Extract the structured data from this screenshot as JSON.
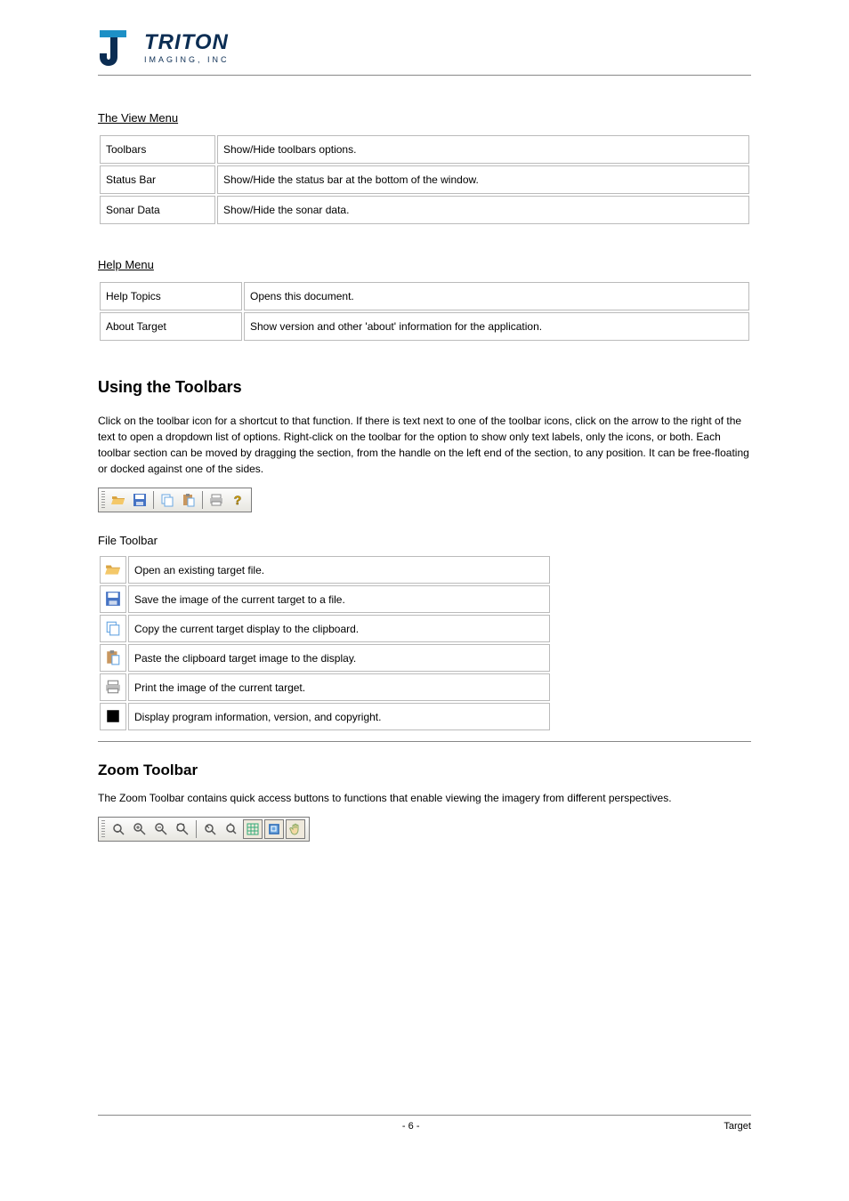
{
  "logo": {
    "company": "TRITON",
    "tagline": "IMAGING, INC"
  },
  "view_menu": {
    "heading": "The View Menu",
    "items": [
      {
        "name": "Toolbars",
        "desc": "Show/Hide toolbars options."
      },
      {
        "name": "Status Bar",
        "desc": "Show/Hide the status bar at the bottom of the window."
      },
      {
        "name": "Sonar Data",
        "desc": "Show/Hide the sonar data."
      }
    ]
  },
  "help_menu": {
    "heading": "Help Menu",
    "items": [
      {
        "name": "Help Topics",
        "desc": "Opens this document."
      },
      {
        "name": "About Target",
        "desc": "Show version and other 'about' information for the application."
      }
    ]
  },
  "toolbars_section": {
    "title": "Using the Toolbars",
    "intro": "Click on the toolbar icon for a shortcut to that function. If there is text next to one of the toolbar icons, click on the arrow to the right of the text to open a dropdown list of options. Right-click on the toolbar for the option to show only text labels, only the icons, or both. Each toolbar section can be moved by dragging the section, from the handle on the left end of the section, to any position. It can be free-floating or docked against one of the sides.",
    "file_toolbar": {
      "desc_title": "File Toolbar",
      "icons": [
        {
          "name": "open-icon",
          "desc": "Open an existing target file."
        },
        {
          "name": "save-icon",
          "desc": "Save the image of the current target to a file."
        },
        {
          "name": "copy-icon",
          "desc": "Copy the current target display to the clipboard."
        },
        {
          "name": "paste-icon",
          "desc": "Paste the clipboard target image to the display."
        },
        {
          "name": "print-icon",
          "desc": "Print the image of the current target."
        },
        {
          "name": "about-icon",
          "desc": "Display program information, version, and copyright."
        }
      ]
    }
  },
  "zoom_toolbar": {
    "heading": "Zoom Toolbar",
    "desc": "The Zoom Toolbar contains quick access buttons to functions that enable viewing the imagery from different perspectives."
  },
  "footer": {
    "center": "- 6 -",
    "right": "Target"
  }
}
